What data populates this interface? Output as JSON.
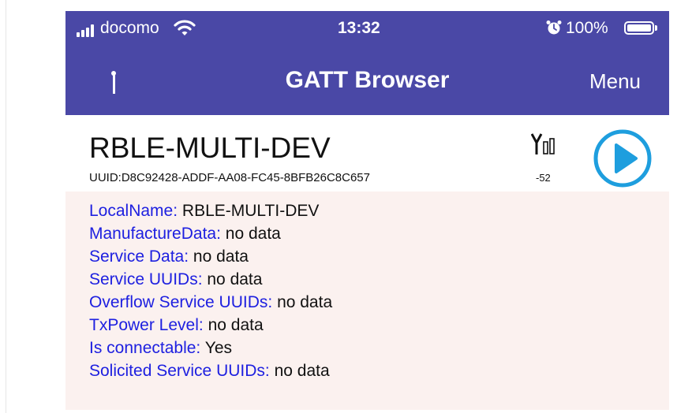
{
  "status_bar": {
    "carrier": "docomo",
    "time": "13:32",
    "battery": "100%"
  },
  "nav": {
    "title": "GATT Browser",
    "menu_label": "Menu"
  },
  "device": {
    "name": "RBLE-MULTI-DEV",
    "uuid": "UUID:D8C92428-ADDF-AA08-FC45-8BFB26C8C657",
    "rssi": "-52"
  },
  "details": [
    {
      "key": "LocalName:",
      "value": "RBLE-MULTI-DEV"
    },
    {
      "key": "ManufactureData:",
      "value": "no data"
    },
    {
      "key": "Service Data:",
      "value": "no data"
    },
    {
      "key": "Service UUIDs:",
      "value": "no data"
    },
    {
      "key": "Overflow Service UUIDs:",
      "value": "no data"
    },
    {
      "key": "TxPower Level:",
      "value": "no data"
    },
    {
      "key": "Is connectable:",
      "value": "Yes"
    },
    {
      "key": "Solicited Service UUIDs:",
      "value": "no data"
    }
  ],
  "icons": {
    "signal": "cellular-signal-icon",
    "wifi": "wifi-icon",
    "alarm": "alarm-icon",
    "battery": "battery-icon",
    "info": "info-icon",
    "antenna": "antenna-signal-icon",
    "connect": "play-circle-icon"
  },
  "colors": {
    "nav_bar": "#4a48a6",
    "key_text": "#1e20e0",
    "details_background": "#fbf1ef",
    "connect_button": "#1e9ede"
  }
}
